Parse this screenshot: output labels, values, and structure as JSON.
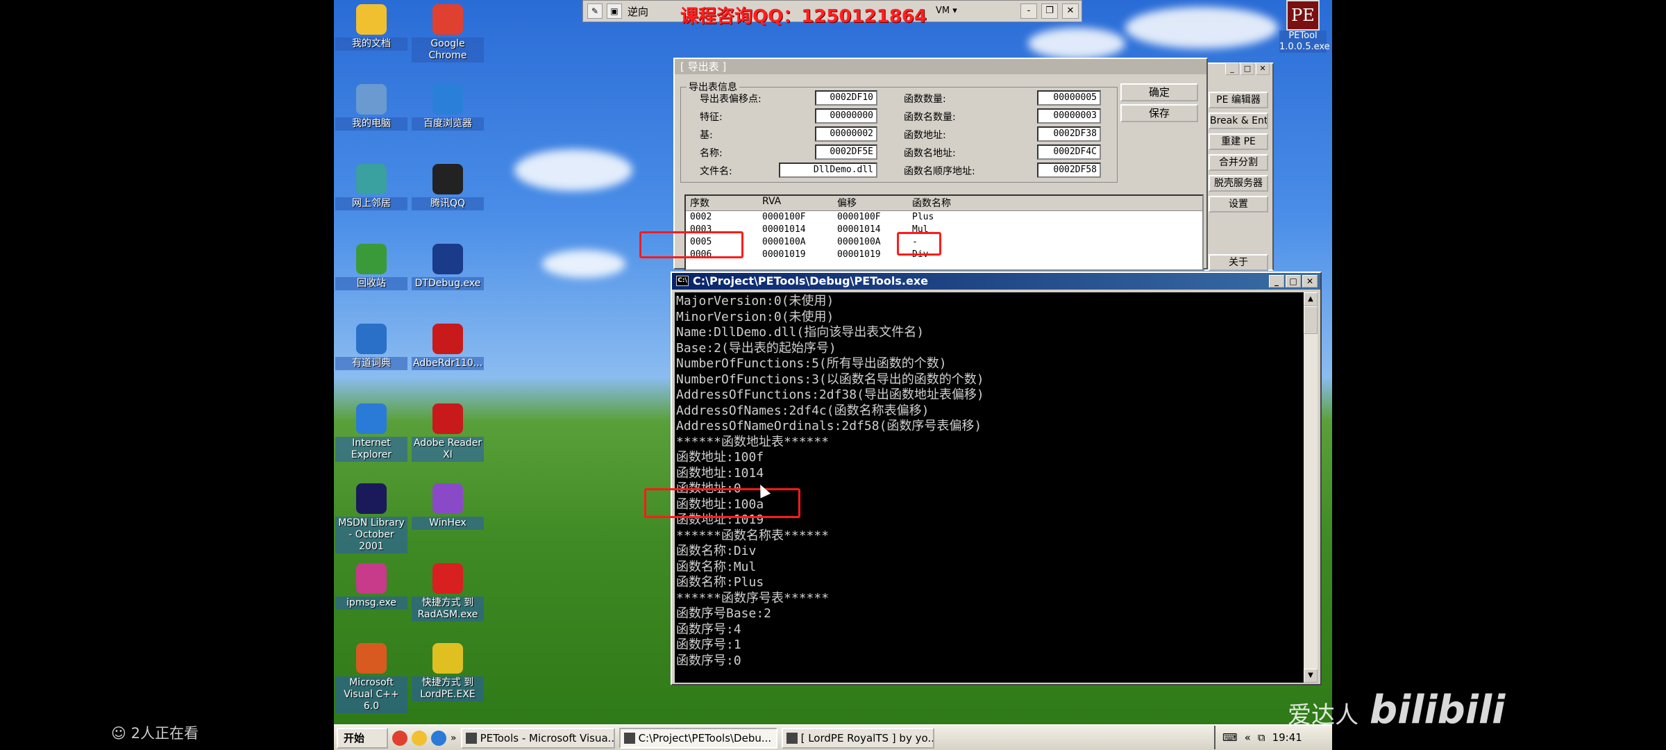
{
  "top_bar": {
    "label": "逆向",
    "ad_text": "课程咨询QQ：1250121864",
    "vm_label": "VM ▾",
    "controls": [
      "-",
      "❐",
      "✕"
    ]
  },
  "desktop_icons": [
    {
      "label": "我的文档",
      "icon": "documents-icon",
      "color": "#f0c030"
    },
    {
      "label": "Google Chrome",
      "icon": "chrome-icon",
      "color": "#e04030"
    },
    {
      "label": "我的电脑",
      "icon": "my-computer-icon",
      "color": "#6a9ad0"
    },
    {
      "label": "百度浏览器",
      "icon": "baidu-browser-icon",
      "color": "#2a80d8"
    },
    {
      "label": "网上邻居",
      "icon": "network-icon",
      "color": "#3aa0a0"
    },
    {
      "label": "腾讯QQ",
      "icon": "qq-icon",
      "color": "#222222"
    },
    {
      "label": "回收站",
      "icon": "recycle-bin-icon",
      "color": "#3a9a3a"
    },
    {
      "label": "DTDebug.exe",
      "icon": "dtdebug-icon",
      "color": "#1a3a8a"
    },
    {
      "label": "有道词典",
      "icon": "youdao-icon",
      "color": "#2a70c8"
    },
    {
      "label": "AdbeRdr110...",
      "icon": "adobe-installer-icon",
      "color": "#c81a1a"
    },
    {
      "label": "Internet Explorer",
      "icon": "ie-icon",
      "color": "#2a7ad8"
    },
    {
      "label": "Adobe Reader XI",
      "icon": "adobe-reader-icon",
      "color": "#c81a1a"
    },
    {
      "label": "MSDN Library - October 2001",
      "icon": "msdn-icon",
      "color": "#1a1a5a"
    },
    {
      "label": "WinHex",
      "icon": "winhex-icon",
      "color": "#8a4ac8"
    },
    {
      "label": "ipmsg.exe",
      "icon": "ipmsg-icon",
      "color": "#c83a8a"
    },
    {
      "label": "快捷方式 到 RadASM.exe",
      "icon": "radasm-icon",
      "color": "#d82020"
    },
    {
      "label": "Microsoft Visual C++ 6.0",
      "icon": "vc6-icon",
      "color": "#d85a20"
    },
    {
      "label": "快捷方式 到 LordPE.EXE",
      "icon": "lordpe-icon",
      "color": "#e0c020"
    }
  ],
  "petool_icon": {
    "box": "PE",
    "label": "PETool 1.0.0.5.exe"
  },
  "export_dialog": {
    "title": "[ 导出表 ]",
    "group_label": "导出表信息",
    "left_fields": [
      {
        "label": "导出表偏移点:",
        "value": "0002DF10"
      },
      {
        "label": "特征:",
        "value": "00000000"
      },
      {
        "label": "基:",
        "value": "00000002"
      },
      {
        "label": "名称:",
        "value": "0002DF5E"
      },
      {
        "label": "文件名:",
        "value": "DllDemo.dll"
      }
    ],
    "right_fields": [
      {
        "label": "函数数量:",
        "value": "00000005"
      },
      {
        "label": "函数名数量:",
        "value": "00000003"
      },
      {
        "label": "函数地址:",
        "value": "0002DF38"
      },
      {
        "label": "函数名地址:",
        "value": "0002DF4C"
      },
      {
        "label": "函数名顺序地址:",
        "value": "0002DF58"
      }
    ],
    "ok_label": "确定",
    "save_label": "保存",
    "table_headers": [
      "序数",
      "RVA",
      "偏移",
      "函数名称"
    ],
    "table_rows": [
      [
        "0002",
        "0000100F",
        "0000100F",
        "Plus"
      ],
      [
        "0003",
        "00001014",
        "00001014",
        "Mul"
      ],
      [
        "0005",
        "0000100A",
        "0000100A",
        "-"
      ],
      [
        "0006",
        "00001019",
        "00001019",
        "Div"
      ]
    ]
  },
  "lordpe_panel": {
    "buttons": [
      "PE 编辑器",
      "Break & Enter",
      "重建 PE",
      "合并分割",
      "脱壳服务器",
      "设置",
      "关于"
    ]
  },
  "console": {
    "title": "C:\\Project\\PETools\\Debug\\PETools.exe",
    "lines": [
      "MajorVersion:0(未使用)",
      "MinorVersion:0(未使用)",
      "Name:DllDemo.dll(指向该导出表文件名)",
      "Base:2(导出表的起始序号)",
      "NumberOfFunctions:5(所有导出函数的个数)",
      "NumberOfFunctions:3(以函数名导出的函数的个数)",
      "AddressOfFunctions:2df38(导出函数地址表偏移)",
      "AddressOfNames:2df4c(函数名称表偏移)",
      "AddressOfNameOrdinals:2df58(函数序号表偏移)",
      "******函数地址表******",
      "函数地址:100f",
      "函数地址:1014",
      "函数地址:0",
      "函数地址:100a",
      "函数地址:1019",
      "******函数名称表******",
      "函数名称:Div",
      "函数名称:Mul",
      "函数名称:Plus",
      "******函数序号表******",
      "函数序号Base:2",
      "函数序号:4",
      "函数序号:1",
      "函数序号:0"
    ]
  },
  "taskbar": {
    "start_label": "开始",
    "tasks": [
      {
        "label": "PETools - Microsoft Visua...",
        "active": false
      },
      {
        "label": "C:\\Project\\PETools\\Debu...",
        "active": true
      },
      {
        "label": "[ LordPE RoyalTS ] by yo...",
        "active": false
      }
    ],
    "tray_arrow": "«",
    "time": "19:41"
  },
  "overlay": {
    "viewers": "2人正在看",
    "watermark_cn": "爱达人",
    "watermark_logo": "bilibili"
  }
}
